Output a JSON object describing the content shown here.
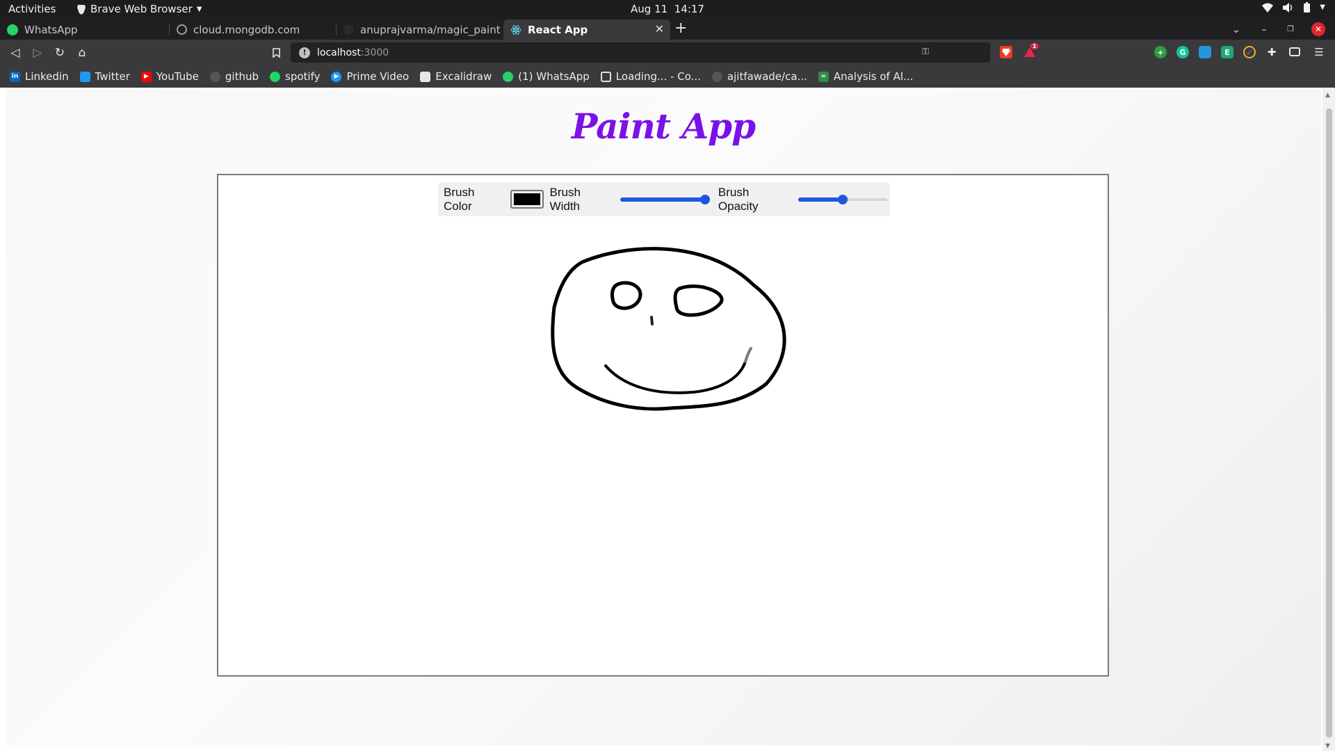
{
  "system_bar": {
    "activities": "Activities",
    "app_menu": "Brave Web Browser",
    "date": "Aug 11",
    "time": "14:17"
  },
  "tabs": [
    {
      "title": "WhatsApp",
      "icon": "whatsapp-icon",
      "color": "#25d366"
    },
    {
      "title": "cloud.mongodb.com",
      "icon": "globe-icon",
      "color": "#9aa0a6"
    },
    {
      "title": "anuprajvarma/magic_paint",
      "icon": "github-icon",
      "color": "#2b2b2b"
    },
    {
      "title": "React App",
      "icon": "react-icon",
      "color": "#61dafb",
      "active": true
    }
  ],
  "toolbar": {
    "url_host": "localhost",
    "url_port": ":3000",
    "brave_badge": "1"
  },
  "bookmarks": [
    {
      "label": "Linkedin",
      "icon": "linkedin-icon",
      "color": "#0a66c2",
      "glyph": "in"
    },
    {
      "label": "Twitter",
      "icon": "twitter-icon",
      "color": "#1d9bf0",
      "glyph": ""
    },
    {
      "label": "YouTube",
      "icon": "youtube-icon",
      "color": "#ff0000",
      "glyph": "▶"
    },
    {
      "label": "github",
      "icon": "github-icon",
      "color": "#555555",
      "glyph": ""
    },
    {
      "label": "spotify",
      "icon": "spotify-icon",
      "color": "#1ed760",
      "glyph": ""
    },
    {
      "label": "Prime Video",
      "icon": "prime-video-icon",
      "color": "#1a98ff",
      "glyph": "▶"
    },
    {
      "label": "Excalidraw",
      "icon": "excalidraw-icon",
      "color": "#e6e6e6",
      "glyph": ""
    },
    {
      "label": "(1) WhatsApp",
      "icon": "whatsapp-icon",
      "color": "#25d366",
      "glyph": ""
    },
    {
      "label": "Loading... - Co...",
      "icon": "page-icon",
      "color": "#3a3a3c",
      "glyph": ""
    },
    {
      "label": "ajitfawade/ca...",
      "icon": "github-icon",
      "color": "#555555",
      "glyph": ""
    },
    {
      "label": "Analysis of Al...",
      "icon": "gfg-icon",
      "color": "#2f8d46",
      "glyph": "∞"
    }
  ],
  "page": {
    "title": "Paint App",
    "brush_color_label": "Brush Color",
    "brush_color": "#000000",
    "brush_width_label": "Brush Width",
    "brush_width_level": 0.95,
    "brush_opacity_label": "Brush Opacity",
    "brush_opacity_level": 0.5,
    "title_color": "#7b11e8",
    "slider_color": "#1f56e0"
  }
}
